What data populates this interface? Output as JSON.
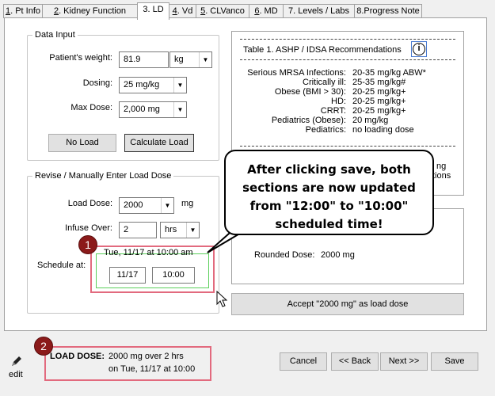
{
  "tabs": [
    {
      "num": "1",
      "label": ". Pt Info",
      "active": false
    },
    {
      "num": "2",
      "label": ". Kidney Function",
      "active": false
    },
    {
      "num": "3",
      "label": ". LD",
      "active": true
    },
    {
      "num": "4",
      "label": ". Vd",
      "active": false
    },
    {
      "num": "5",
      "label": ". CLVanco",
      "active": false
    },
    {
      "num": "6",
      "label": ". MD",
      "active": false
    },
    {
      "num": "7",
      "label": ". Levels / Labs",
      "active": false
    },
    {
      "num": "8",
      "label": ".Progress Note",
      "active": false
    }
  ],
  "data_input": {
    "legend": "Data Input",
    "weight_label": "Patient's weight:",
    "weight_value": "81.9",
    "weight_unit": "kg",
    "dosing_label": "Dosing:",
    "dosing_value": "25 mg/kg",
    "max_dose_label": "Max Dose:",
    "max_dose_value": "2,000 mg",
    "no_load_button": "No Load",
    "calculate_button": "Calculate Load"
  },
  "revise": {
    "legend": "Revise / Manually Enter Load Dose",
    "load_dose_label": "Load Dose:",
    "load_dose_value": "2000",
    "load_dose_unit": "mg",
    "infuse_label": "Infuse Over:",
    "infuse_value": "2",
    "infuse_unit": "hrs",
    "schedule_label": "Schedule at:",
    "schedule_text": "Tue, 11/17 at 10:00 am",
    "schedule_date": "11/17",
    "schedule_time": "10:00"
  },
  "recommendations": {
    "title": "Table 1.  ASHP / IDSA Recommendations",
    "info_icon": "info-icon",
    "rows": [
      {
        "k": "Serious MRSA Infections:",
        "v": "20-35 mg/kg ABW*"
      },
      {
        "k": "Critically ill:",
        "v": "25-35 mg/kg#"
      },
      {
        "k": "Obese (BMI > 30):",
        "v": "20-25 mg/kg+"
      },
      {
        "k": "HD:",
        "v": "20-25 mg/kg+"
      },
      {
        "k": "CRRT:",
        "v": "20-25 mg/kg+"
      },
      {
        "k": "Pediatrics (Obese):",
        "v": "20 mg/kg"
      },
      {
        "k": "Pediatrics:",
        "v": "no loading dose"
      }
    ],
    "hidden_frag_1": "ng",
    "hidden_frag_2": "tions"
  },
  "rounded": {
    "label": "Rounded Dose:",
    "value": "2000 mg"
  },
  "accept_button": "Accept \"2000 mg\" as load dose",
  "callout": {
    "line1": "After clicking save, both",
    "line2": "sections are now updated",
    "line3": "from \"12:00\" to \"10:00\"",
    "line4": "scheduled time!"
  },
  "badges": {
    "first": "1",
    "second": "2"
  },
  "bottom": {
    "edit_label": "edit",
    "load_dose_label": "LOAD DOSE:",
    "load_line1": "2000 mg over 2 hrs",
    "load_line2": "on Tue, 11/17 at 10:00",
    "cancel_button": "Cancel",
    "back_button": "<< Back",
    "next_button": "Next >>",
    "save_button": "Save"
  },
  "colors": {
    "annotation_red": "#8b1a1a",
    "highlight_pink": "#e26a7e",
    "highlight_green": "#5bd05b"
  }
}
